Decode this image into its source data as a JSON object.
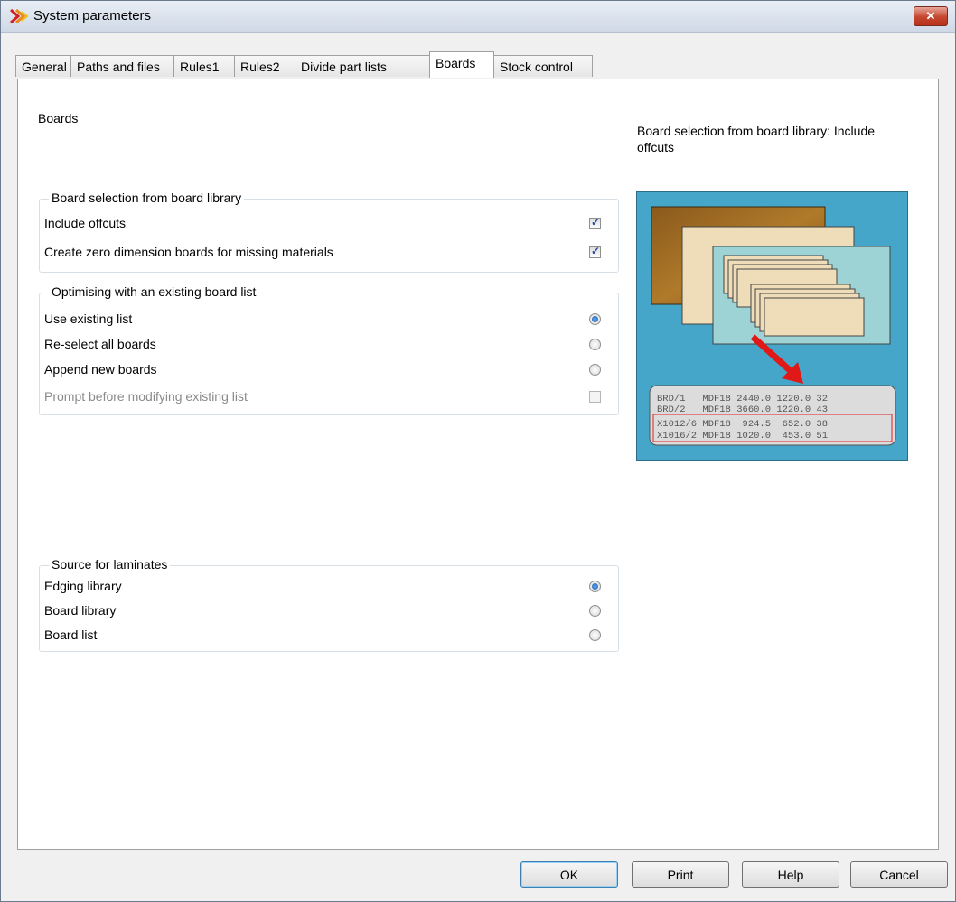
{
  "window": {
    "title": "System parameters",
    "close_label": "✕"
  },
  "tabs": [
    {
      "label": "General"
    },
    {
      "label": "Paths and files"
    },
    {
      "label": "Rules1"
    },
    {
      "label": "Rules2"
    },
    {
      "label": "Divide part lists"
    },
    {
      "label": "Boards"
    },
    {
      "label": "Stock control"
    }
  ],
  "active_tab": "Boards",
  "page": {
    "section_title": "Boards",
    "help_text": "Board selection from board library: Include offcuts"
  },
  "board_selection": {
    "legend": "Board selection from board library",
    "items": [
      {
        "label": "Include offcuts",
        "checked": true
      },
      {
        "label": "Create zero dimension boards for missing materials",
        "checked": true
      }
    ]
  },
  "optimising": {
    "legend": "Optimising with an existing board list",
    "options": [
      {
        "label": "Use existing list",
        "selected": true
      },
      {
        "label": "Re-select all boards",
        "selected": false
      },
      {
        "label": "Append new boards",
        "selected": false
      }
    ],
    "prompt": {
      "label": "Prompt before modifying existing list",
      "checked": false,
      "disabled": true
    }
  },
  "laminates": {
    "legend": "Source for laminates",
    "options": [
      {
        "label": "Edging library",
        "selected": true
      },
      {
        "label": "Board library",
        "selected": false
      },
      {
        "label": "Board list",
        "selected": false
      }
    ]
  },
  "illustration": {
    "rows": [
      "BRD/1   MDF18 2440.0 1220.0 32",
      "BRD/2   MDF18 3660.0 1220.0 43",
      "X1012/6 MDF18  924.5  652.0 38",
      "X1016/2 MDF18 1020.0  453.0 51"
    ]
  },
  "buttons": {
    "ok": "OK",
    "print": "Print",
    "help": "Help",
    "cancel": "Cancel"
  }
}
